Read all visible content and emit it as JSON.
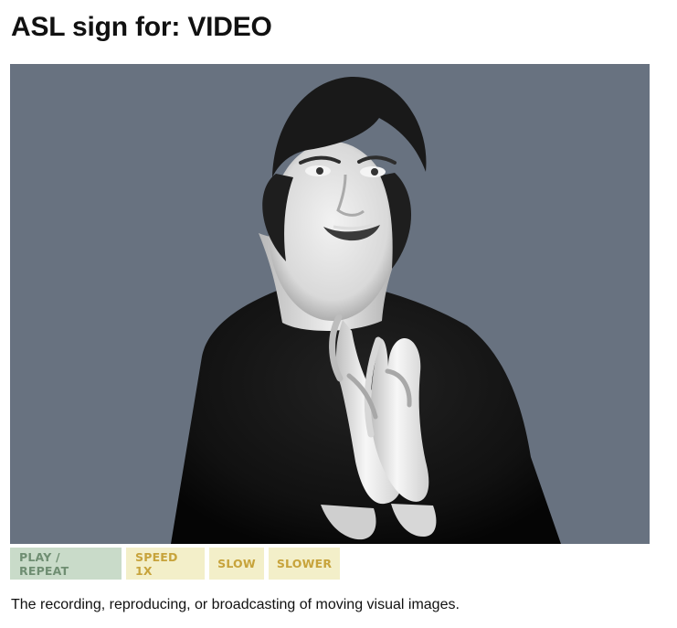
{
  "page": {
    "title": "ASL sign for: VIDEO",
    "definition": "The recording, reproducing, or broadcasting of moving visual images."
  },
  "video": {
    "background_color": "#687280",
    "subject": "signer-video-frame"
  },
  "controls": {
    "play_label": "PLAY / REPEAT",
    "speed_label": "SPEED 1X",
    "slow_label": "SLOW",
    "slower_label": "SLOWER"
  },
  "colors": {
    "play_bg": "#c9dbc9",
    "play_text": "#6f8e72",
    "speed_bg": "#f3efc9",
    "speed_text": "#c7a33b"
  }
}
